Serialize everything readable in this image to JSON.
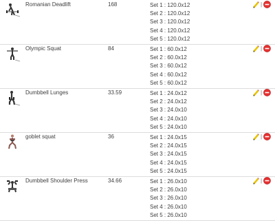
{
  "workouts": [
    {
      "thumb_icon": "deadlift-figure-icon",
      "name": "Romanian Deadlift",
      "score": "168",
      "sets": [
        "Set 1 : 120.0x12",
        "Set 2 : 120.0x12",
        "Set 3 : 120.0x12",
        "Set 4 : 120.0x12",
        "Set 5 : 120.0x12"
      ]
    },
    {
      "thumb_icon": "squat-figure-icon",
      "name": "Olympic Squat",
      "score": "84",
      "sets": [
        "Set 1 : 60.0x12",
        "Set 2 : 60.0x12",
        "Set 3 : 60.0x12",
        "Set 4 : 60.0x12",
        "Set 5 : 60.0x12"
      ]
    },
    {
      "thumb_icon": "lunge-figure-icon",
      "name": "Dumbbell Lunges",
      "score": "33.59",
      "sets": [
        "Set 1 : 24.0x12",
        "Set 2 : 24.0x12",
        "Set 3 : 24.0x10",
        "Set 4 : 24.0x10",
        "Set 5 : 24.0x10"
      ]
    },
    {
      "thumb_icon": "goblet-squat-figure-icon",
      "name": "goblet squat",
      "score": "36",
      "sets": [
        "Set 1 : 24.0x15",
        "Set 2 : 24.0x15",
        "Set 3 : 24.0x15",
        "Set 4 : 24.0x15",
        "Set 5 : 24.0x15"
      ]
    },
    {
      "thumb_icon": "shoulder-press-figure-icon",
      "name": "Dumbbell Shoulder Press",
      "score": "34.66",
      "sets": [
        "Set 1 : 26.0x10",
        "Set 2 : 26.0x10",
        "Set 3 : 26.0x10",
        "Set 4 : 26.0x10",
        "Set 5 : 26.0x10"
      ]
    }
  ],
  "actions": {
    "edit_icon": "pencil-icon",
    "separator": "|",
    "delete_icon": "delete-icon"
  },
  "colors": {
    "edit": "#e8c400",
    "delete": "#e53030",
    "divider": "#dcdcdc"
  }
}
